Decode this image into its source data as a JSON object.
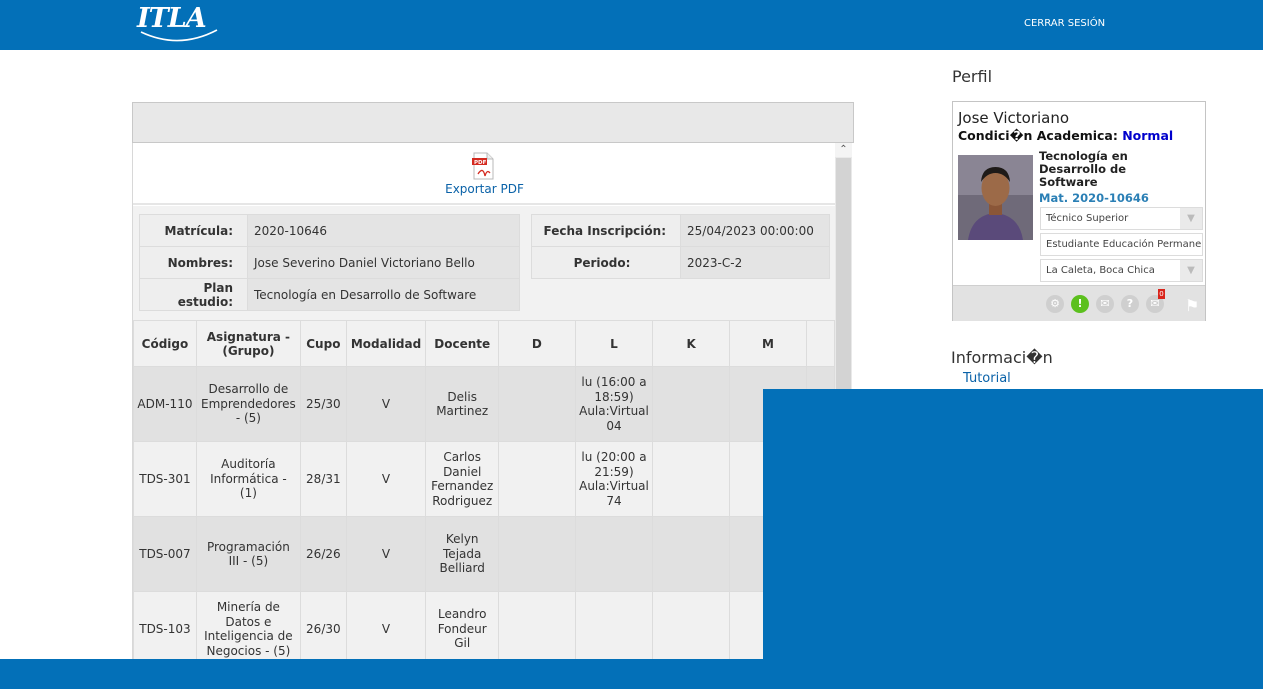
{
  "header": {
    "logo_text": "ITLA",
    "logout_label": "CERRAR SESIÓN"
  },
  "panel": {
    "export_label": "Exportar PDF",
    "export_icon": "pdf-file-icon",
    "student_info": {
      "matricula_label": "Matrícula:",
      "matricula_value": "2020-10646",
      "nombres_label": "Nombres:",
      "nombres_value": "Jose Severino Daniel Victoriano Bello",
      "plan_label": "Plan estudio:",
      "plan_value": "Tecnología en Desarrollo de Software",
      "fecha_label": "Fecha Inscripción:",
      "fecha_value": "25/04/2023 00:00:00",
      "periodo_label": "Periodo:",
      "periodo_value": "2023-C-2"
    },
    "table": {
      "headers": [
        "Código",
        "Asignatura - (Grupo)",
        "Cupo",
        "Modalidad",
        "Docente",
        "D",
        "L",
        "K",
        "M"
      ],
      "rows": [
        [
          "ADM-110",
          "Desarrollo de Emprendedores - (5)",
          "25/30",
          "V",
          "Delis Martinez",
          "",
          "lu (16:00 a 18:59) Aula:Virtual 04",
          "",
          ""
        ],
        [
          "TDS-301",
          "Auditoría Informática - (1)",
          "28/31",
          "V",
          "Carlos Daniel Fernandez Rodriguez",
          "",
          "lu (20:00 a 21:59) Aula:Virtual 74",
          "",
          ""
        ],
        [
          "TDS-007",
          "Programación III - (5)",
          "26/26",
          "V",
          "Kelyn Tejada Belliard",
          "",
          "",
          "",
          ""
        ],
        [
          "TDS-103",
          "Minería de Datos e Inteligencia de Negocios - (5)",
          "26/30",
          "V",
          "Leandro Fondeur Gil",
          "",
          "",
          "",
          ""
        ]
      ]
    }
  },
  "sidebar": {
    "profile_title": "Perfil",
    "name": "Jose Victoriano",
    "condition_label": "Condici�n Academica:",
    "condition_value": "Normal",
    "career": "Tecnología en Desarrollo de Software",
    "matricula": "Mat. 2020-10646",
    "select_level": "Técnico Superior",
    "select_area": "Estudiante Educación Permanente",
    "select_campus": "La Caleta, Boca Chica",
    "notification_count": "0",
    "icons": [
      "gear-icon",
      "alert-icon",
      "mail-icon",
      "help-icon",
      "messages-icon",
      "flag-icon"
    ],
    "info_title": "Informaci�n",
    "tutorial_label": "Tutorial"
  },
  "colors": {
    "brand_blue": "#0370b8",
    "link_blue": "#0a62a8",
    "status_ok": "#5cc01e"
  }
}
